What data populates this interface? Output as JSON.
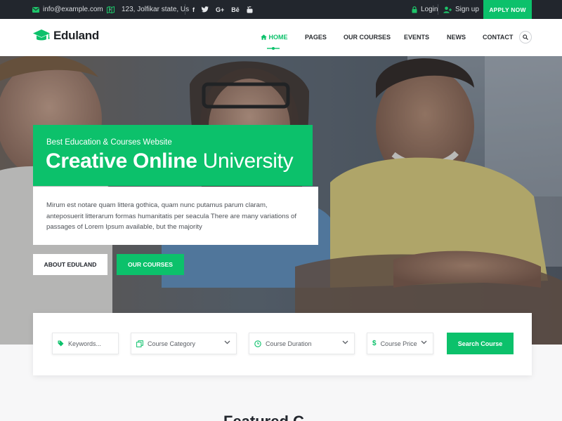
{
  "topbar": {
    "email": "info@example.com",
    "address": "123, Jolfikar state, Us",
    "social": [
      "f",
      "twitter-icon",
      "G+",
      "Bē",
      "youtube-icon"
    ],
    "login": "Login",
    "signup": "Sign up",
    "apply": "APPLY NOW"
  },
  "brand": {
    "name": "Eduland",
    "accent": "#0cc16b"
  },
  "nav": {
    "items": [
      "HOME",
      "PAGES",
      "OUR COURSES",
      "EVENTS",
      "NEWS",
      "CONTACT"
    ],
    "active": "HOME"
  },
  "hero": {
    "subtitle": "Best Education & Courses Website",
    "title_bold": "Creative Online",
    "title_light": "University",
    "description": "Mirum est notare quam littera gothica, quam nunc putamus parum claram, anteposuerit litterarum formas humanitatis per seacula There are many variations of passages of Lorem Ipsum available, but the majority",
    "btn_about": "ABOUT EDULAND",
    "btn_courses": "OUR COURSES"
  },
  "search": {
    "keywords_placeholder": "Keywords...",
    "category": "Course Category",
    "duration": "Course Duration",
    "price": "Course Price",
    "submit": "Search Course"
  },
  "section": {
    "featured_partial": "Featured C"
  }
}
